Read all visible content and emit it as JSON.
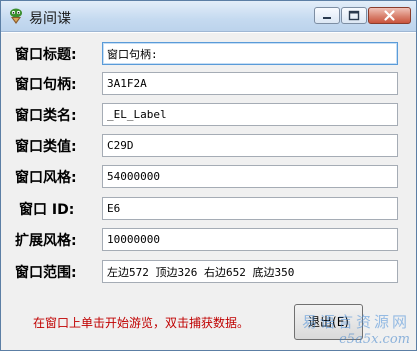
{
  "window": {
    "title": "易间谍",
    "minimize_icon": "minimize-icon",
    "maximize_icon": "maximize-icon",
    "close_icon": "close-icon"
  },
  "fields": [
    {
      "label": "窗口标题:",
      "value": "窗口句柄:",
      "active": true
    },
    {
      "label": "窗口句柄:",
      "value": "3A1F2A"
    },
    {
      "label": "窗口类名:",
      "value": "_EL_Label"
    },
    {
      "label": "窗口类值:",
      "value": "C29D"
    },
    {
      "label": "窗口风格:",
      "value": "54000000"
    },
    {
      "label": "窗口 ID:",
      "value": "E6"
    },
    {
      "label": "扩展风格:",
      "value": "10000000"
    },
    {
      "label": "窗口范围:",
      "value": "左边572 顶边326 右边652 底边350"
    }
  ],
  "status_text": "在窗口上单击开始游览，双击捕获数据。",
  "exit_button_label": "退出(E)",
  "watermark": {
    "line1": "易语言资源网",
    "line2": "e5a5x.com"
  },
  "colors": {
    "status": "#c00000",
    "titlebar": "#c5daf0",
    "close_button": "#c9533c"
  }
}
